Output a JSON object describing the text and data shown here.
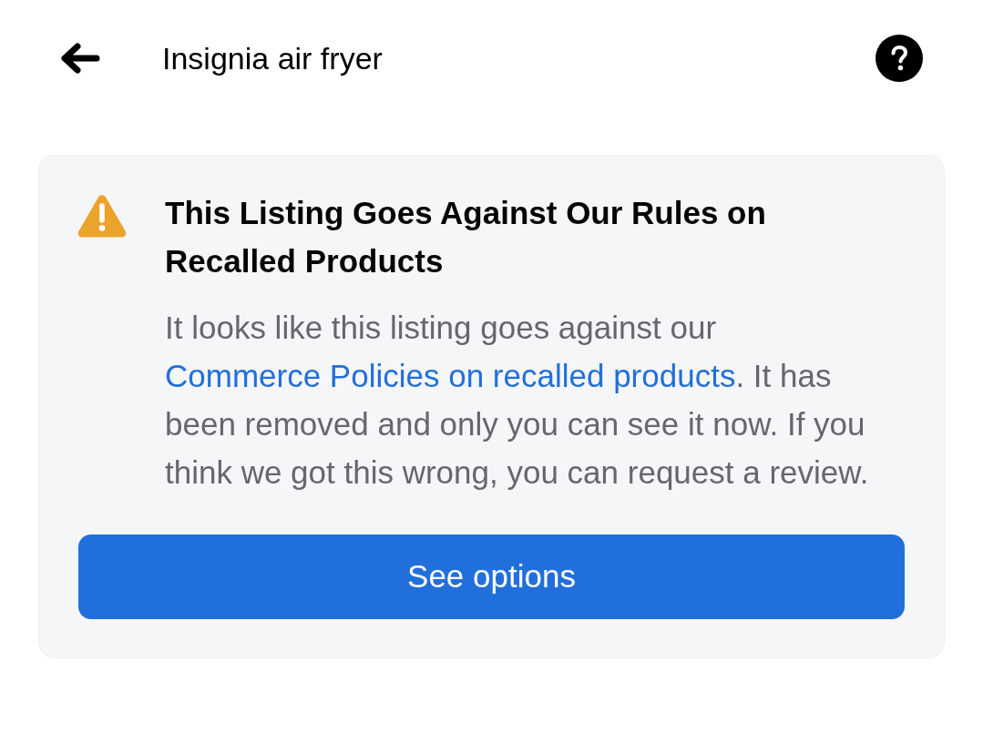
{
  "header": {
    "title": "Insignia air fryer"
  },
  "notice": {
    "heading": "This Listing Goes Against Our Rules on Recalled Products",
    "body_before": "It looks like this listing goes against our ",
    "link": "Commerce Policies on recalled products",
    "body_after": ". It has been removed and only you can see it now. If you think we got this wrong, you can request a review.",
    "button": "See options"
  }
}
